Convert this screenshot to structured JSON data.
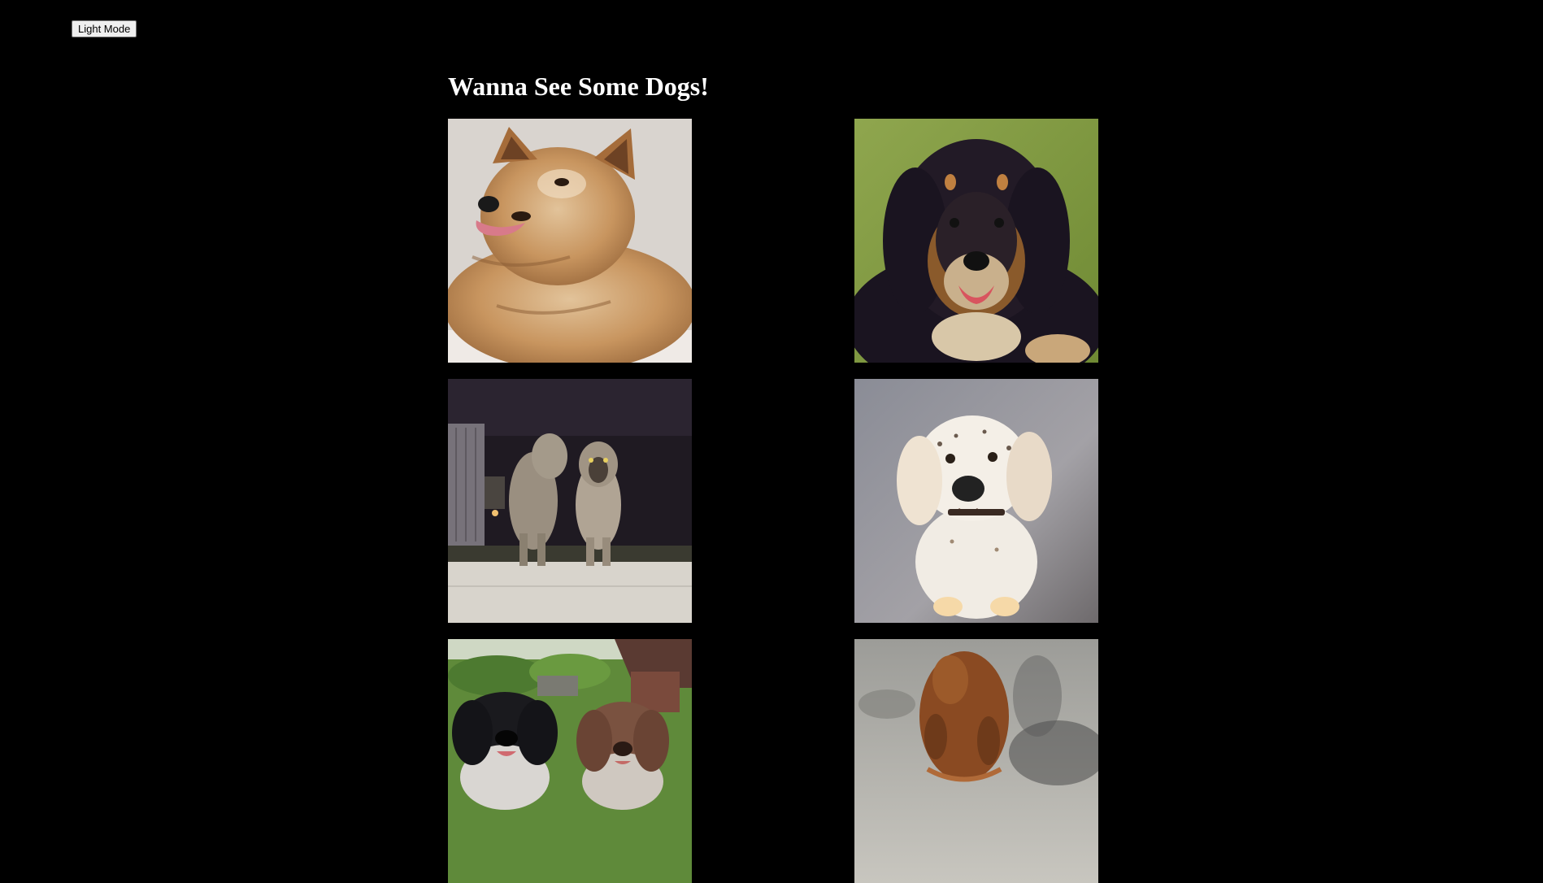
{
  "toggle": {
    "label": "Light Mode"
  },
  "page": {
    "title": "Wanna See Some Dogs!"
  },
  "colors": {
    "background": "#000000",
    "text": "#ffffff"
  },
  "gallery": {
    "items": [
      {
        "subject": "fluffy tan terrier, head tilted, tongue out"
      },
      {
        "subject": "black-and-tan long-haired mastiff on grass"
      },
      {
        "subject": "two large gray shepherd dogs standing on a wall at night"
      },
      {
        "subject": "white speckled setter puppy sitting on pavement"
      },
      {
        "subject": "two curly water dogs, black and brown, in a garden"
      },
      {
        "subject": "red-brown dog walking on snowy ground"
      }
    ]
  }
}
